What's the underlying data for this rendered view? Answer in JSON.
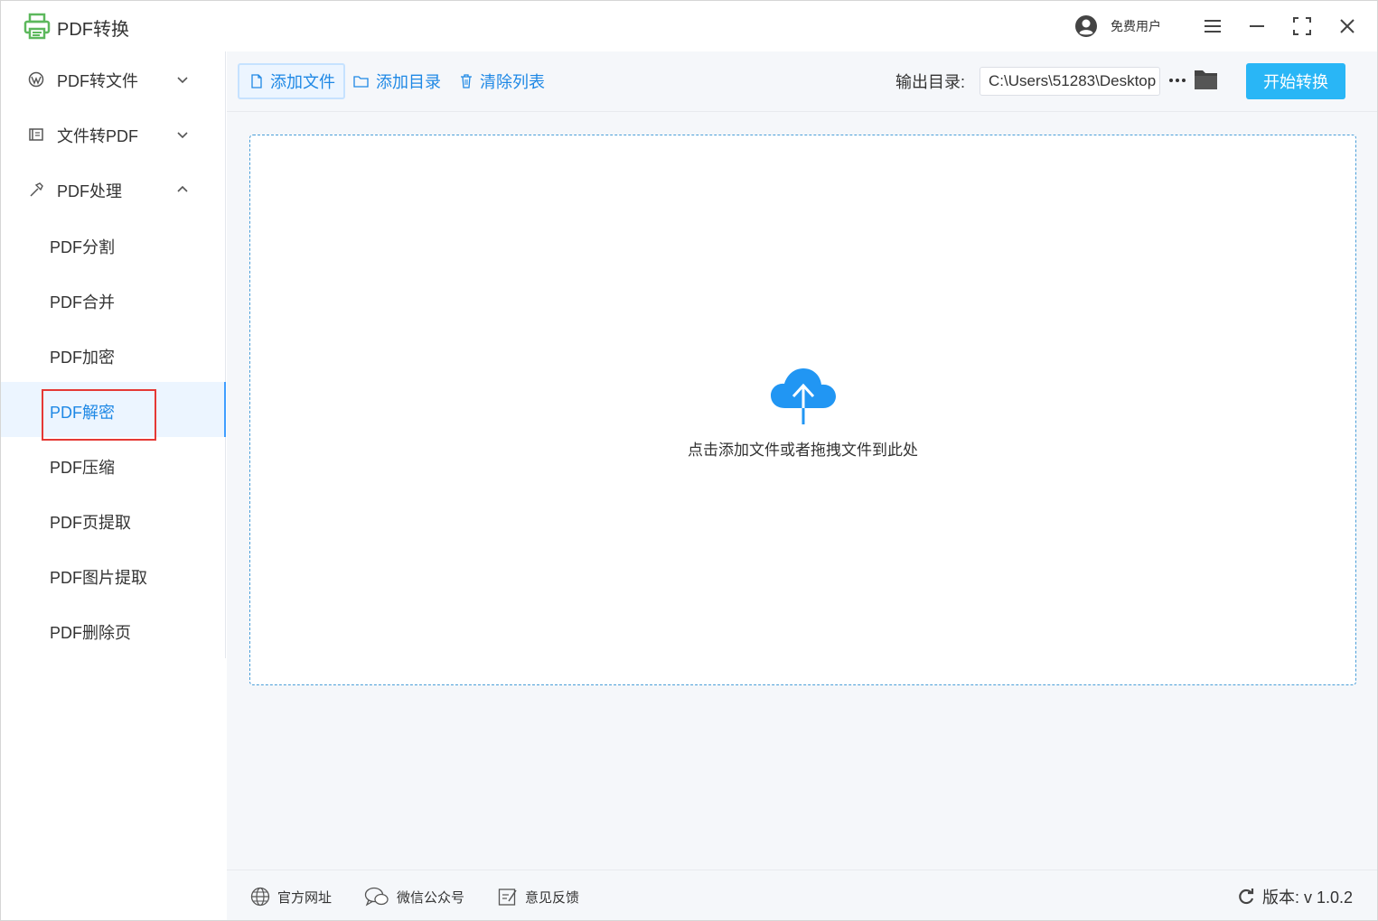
{
  "app": {
    "title": "PDF转换"
  },
  "user": {
    "name": "免费用户"
  },
  "sidebar": {
    "groups": [
      {
        "label": "PDF转文件",
        "expanded": false
      },
      {
        "label": "文件转PDF",
        "expanded": false
      },
      {
        "label": "PDF处理",
        "expanded": true
      }
    ],
    "items": [
      {
        "label": "PDF分割"
      },
      {
        "label": "PDF合并"
      },
      {
        "label": "PDF加密"
      },
      {
        "label": "PDF解密"
      },
      {
        "label": "PDF压缩"
      },
      {
        "label": "PDF页提取"
      },
      {
        "label": "PDF图片提取"
      },
      {
        "label": "PDF删除页"
      }
    ],
    "active_item": "PDF解密"
  },
  "toolbar": {
    "add_file": "添加文件",
    "add_dir": "添加目录",
    "clear_list": "清除列表",
    "output_label": "输出目录:",
    "output_path": "C:\\Users\\51283\\Desktop",
    "start": "开始转换"
  },
  "dropzone": {
    "text": "点击添加文件或者拖拽文件到此处"
  },
  "footer": {
    "website": "官方网址",
    "wechat": "微信公众号",
    "feedback": "意见反馈",
    "version": "版本:  v 1.0.2"
  },
  "colors": {
    "accent": "#1e88e5",
    "button": "#29b6f6",
    "logo": "#5cb85c",
    "highlight": "#e53935"
  }
}
